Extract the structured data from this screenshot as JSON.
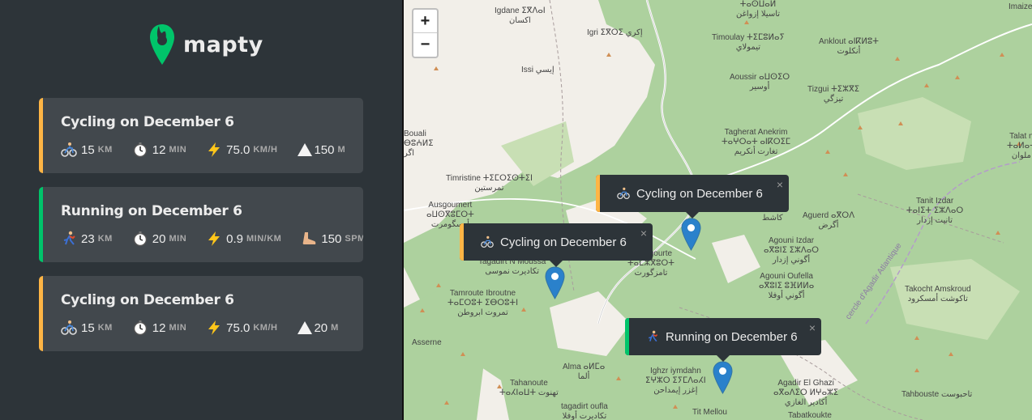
{
  "app": {
    "name": "mapty"
  },
  "workouts": [
    {
      "type": "cycling",
      "title": "Cycling on December 6",
      "color": "#ffb545",
      "distance": "15",
      "distance_unit": "KM",
      "duration": "12",
      "duration_unit": "MIN",
      "speed": "75.0",
      "speed_unit": "KM/H",
      "elevation": "150",
      "elevation_unit": "M"
    },
    {
      "type": "running",
      "title": "Running on December 6",
      "color": "#00c46a",
      "distance": "23",
      "distance_unit": "KM",
      "duration": "20",
      "duration_unit": "MIN",
      "pace": "0.9",
      "pace_unit": "MIN/KM",
      "cadence": "150",
      "cadence_unit": "SPM"
    },
    {
      "type": "cycling",
      "title": "Cycling on December 6",
      "color": "#ffb545",
      "distance": "15",
      "distance_unit": "KM",
      "duration": "12",
      "duration_unit": "MIN",
      "speed": "75.0",
      "speed_unit": "KM/H",
      "elevation": "20",
      "elevation_unit": "M"
    }
  ],
  "map": {
    "zoom_in": "+",
    "zoom_out": "−",
    "popups": [
      {
        "label": "Cycling on December 6",
        "color": "#ffb545",
        "icon": "cyclist-icon"
      },
      {
        "label": "Cycling on December 6",
        "color": "#ffb545",
        "icon": "cyclist-icon"
      },
      {
        "label": "Running on December 6",
        "color": "#00c46a",
        "icon": "runner-icon"
      }
    ],
    "close": "×",
    "labels": [
      "Igdane ⵉⴳⴷⴰⵏ",
      "اكسان",
      "Igri ⵉⴳⵔⵉ إكري",
      "Issi إيسي",
      "Timoulay ⵜⵉⵎⵓⵍⴰⵢ",
      "تيمولاي",
      "Anklout ⴰⵏⴽⵍⵓⵜ",
      "أنكلوت",
      "Aoussir ⴰⵡⵙⵉⵔ",
      "أوسير",
      "Tizgui ⵜⵉⵣⴳⵉ",
      "تيزگي",
      "Tagherat Anekrim",
      "ⵜⴰⵖⵔⴰⵜ ⴰⵏⴽⵔⵉⵎ",
      "تغارت أنكريم",
      "Bouali",
      "ⴱⵓⵄⵍⵉ",
      "اگر",
      "Timristine ⵜⵉⵎⵔⵉⵙⵜⵉⵏ",
      "تمرستين",
      "Ausgoumert",
      "ⴰⵡⵙⴳⵓⵎⵔⵜ",
      "أوسگومرت",
      "Tanit Izdar",
      "ⵜⴰⵏⵉⵜ ⵉⵣⴷⴰⵔ",
      "تانيت إزدار",
      "Aguerd ⴰⴳⵔⴷ",
      "أگرض",
      "كاشط",
      "Agouni Izdar",
      "ⴰⴳⵓⵏⵉ ⵉⵣⴷⴰⵔ",
      "أگوني إزدار",
      "Agouni Oufella",
      "ⴰⴳⵓⵏⵉ ⵓⴼⵍⵍⴰ",
      "أگوني أوفلا",
      "Tagadirt N Moussa",
      "تكاديرت نموسى",
      "Tamzgourte",
      "ⵜⴰⵎⵣⴳⵓⵔⵜ",
      "تامزگورت",
      "Tamroute Ibroutne",
      "ⵜⴰⵎⵔⵓⵜ ⵉⴱⵔⵓⵜⵏ",
      "تمروت ابروطن",
      "Takocht Amskroud",
      "تاكوشت أمسكرود",
      "Asserne",
      "Alma ⴰⵍⵎⴰ",
      "ألما",
      "Ighzr iymdahn",
      "ⵉⵖⵣⵔ ⵉⵢⵎⴷⴰⵃⵏ",
      "إغزر إيمداحن",
      "Tahanoute",
      "ⵜⴰⵃⵏⴰⵡⵜ تهنوت",
      "tagadirt oufla",
      "تكاديرت أوفلا",
      "Tit Mellou",
      "Agadir El Ghazi",
      "ⴰⴳⴰⴷⵉⵔ ⵍⵖⴰⵣⵉ",
      "أكادير الغازي",
      "Tahbouste تاحبوست",
      "Tabatkoukte",
      "cercle d'Agadir Atlantique",
      "Imaize",
      "Talat n",
      "ⵜⴰⵍⴰⵜ",
      "ملوان",
      "ⵜⴰⵙⵡⴰⵍ",
      "تاسيلا إزواغن"
    ]
  }
}
